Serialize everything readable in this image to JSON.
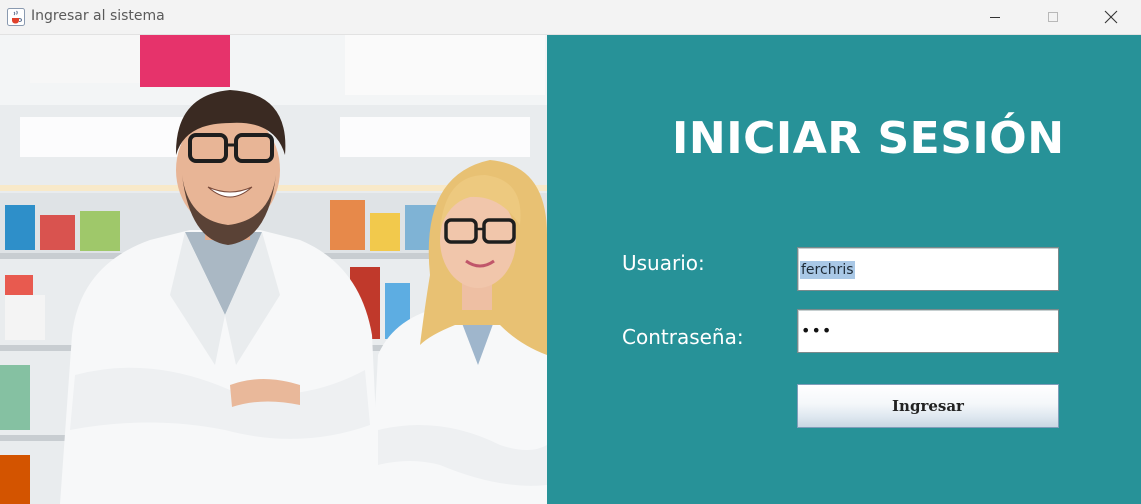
{
  "window": {
    "title": "Ingresar al sistema",
    "icon": "java-cup-icon",
    "controls": [
      "minimize-icon",
      "maximize-icon",
      "close-icon"
    ]
  },
  "hero": {
    "image": "pharmacists-photo"
  },
  "login": {
    "heading": "INICIAR SESIÓN",
    "user_label": "Usuario:",
    "user_value": "ferchris",
    "password_label": "Contraseña:",
    "password_mask": "•••",
    "submit_label": "Ingresar"
  },
  "colors": {
    "panel": "#279298",
    "text": "#ffffff",
    "selection": "#a9c8e6"
  }
}
